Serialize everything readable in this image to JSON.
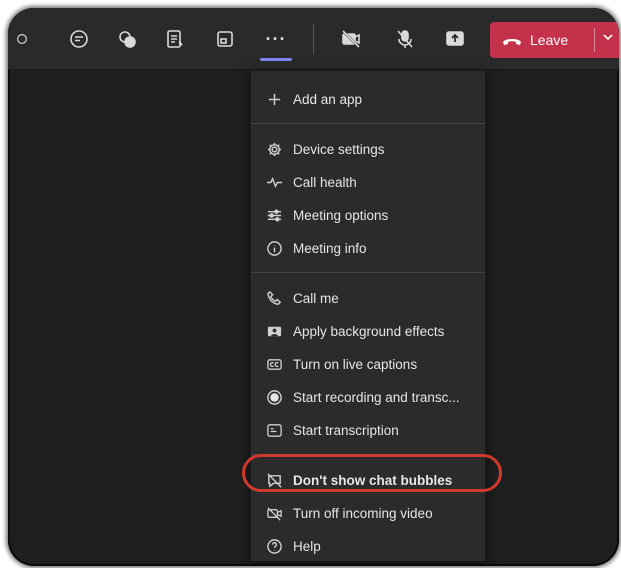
{
  "toolbar": {
    "buttons": [
      {
        "icon": "chat-icon"
      },
      {
        "icon": "reactions-icon"
      },
      {
        "icon": "notes-icon"
      },
      {
        "icon": "share-tray-icon"
      },
      {
        "icon": "more-options-icon",
        "label": "···"
      },
      {
        "icon": "camera-off-icon"
      },
      {
        "icon": "mic-off-icon"
      },
      {
        "icon": "share-screen-icon"
      }
    ],
    "leave_label": "Leave",
    "leave_color": "#c4314b"
  },
  "menu": {
    "items": [
      {
        "label": "Add an app",
        "icon": "plus-icon"
      },
      {
        "label": "Device settings",
        "icon": "gear-icon"
      },
      {
        "label": "Call health",
        "icon": "pulse-icon"
      },
      {
        "label": "Meeting options",
        "icon": "sliders-icon"
      },
      {
        "label": "Meeting info",
        "icon": "info-icon"
      },
      {
        "label": "Call me",
        "icon": "phone-icon"
      },
      {
        "label": "Apply background effects",
        "icon": "background-effects-icon"
      },
      {
        "label": "Turn on live captions",
        "icon": "captions-icon"
      },
      {
        "label": "Start recording and transc...",
        "icon": "record-icon"
      },
      {
        "label": "Start transcription",
        "icon": "transcript-icon"
      },
      {
        "label": "Don't show chat bubbles",
        "icon": "chat-bubble-off-icon",
        "highlighted": true
      },
      {
        "label": "Turn off incoming video",
        "icon": "video-off-icon"
      },
      {
        "label": "Help",
        "icon": "help-icon"
      }
    ]
  },
  "colors": {
    "background": "#1f1f1f",
    "menu_bg": "#2b2b2b",
    "accent": "#7f85f5",
    "highlight_ring": "#d0392b"
  }
}
